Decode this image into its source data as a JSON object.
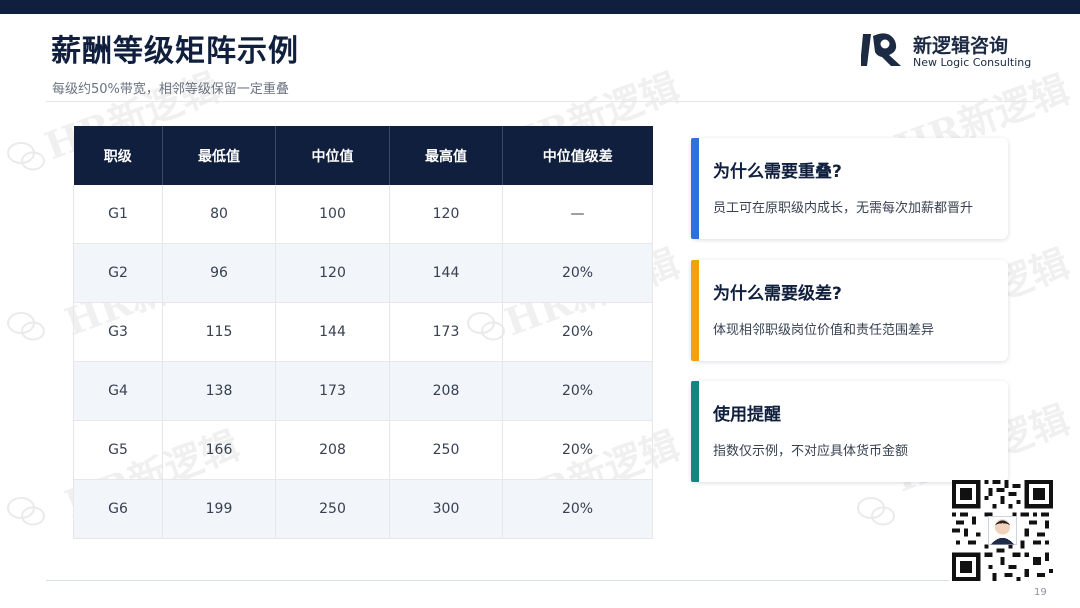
{
  "header": {
    "title": "薪酬等级矩阵示例",
    "subtitle": "每级约50%带宽，相邻等级保留一定重叠"
  },
  "brand": {
    "name_cn": "新逻辑咨询",
    "name_en": "New Logic Consulting",
    "watermark_text": "HR新逻辑"
  },
  "table": {
    "headers": [
      "职级",
      "最低值",
      "中位值",
      "最高值",
      "中位值级差"
    ],
    "rows": [
      [
        "G1",
        "80",
        "100",
        "120",
        "—"
      ],
      [
        "G2",
        "96",
        "120",
        "144",
        "20%"
      ],
      [
        "G3",
        "115",
        "144",
        "173",
        "20%"
      ],
      [
        "G4",
        "138",
        "173",
        "208",
        "20%"
      ],
      [
        "G5",
        "166",
        "208",
        "250",
        "20%"
      ],
      [
        "G6",
        "199",
        "250",
        "300",
        "20%"
      ]
    ]
  },
  "cards": [
    {
      "title": "为什么需要重叠?",
      "text": "员工可在原职级内成长，无需每次加薪都晋升",
      "accent": "#2f6fe0"
    },
    {
      "title": "为什么需要级差?",
      "text": "体现相邻职级岗位价值和责任范围差异",
      "accent": "#f2a20e"
    },
    {
      "title": "使用提醒",
      "text": "指数仅示例，不对应具体货币金额",
      "accent": "#17847f"
    }
  ],
  "footer": {
    "page_number": "19"
  },
  "colors": {
    "navy": "#0f1f3d",
    "row_alt": "#f2f5f9",
    "table_border": "#e5e7eb"
  },
  "icons": {
    "logo": "logo-mark-icon",
    "qr": "qr-code-icon",
    "wechat": "wechat-icon"
  }
}
